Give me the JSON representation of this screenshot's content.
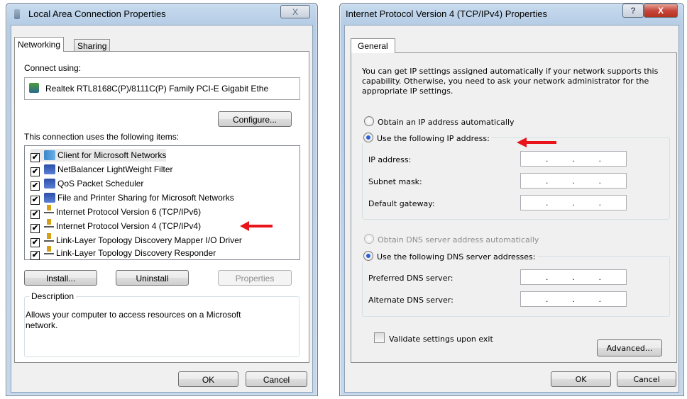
{
  "left_window": {
    "title": "Local Area Connection Properties",
    "tabs": [
      "Networking",
      "Sharing"
    ],
    "connect_using_label": "Connect using:",
    "adapter_name": "Realtek RTL8168C(P)/8111C(P) Family PCI-E Gigabit Ethe",
    "configure_button": "Configure...",
    "items_label": "This connection uses the following items:",
    "items": [
      {
        "label": "Client for Microsoft Networks",
        "checked": true,
        "icon": "network-client-icon"
      },
      {
        "label": "NetBalancer LightWeight Filter",
        "checked": true,
        "icon": "network-service-icon"
      },
      {
        "label": "QoS Packet Scheduler",
        "checked": true,
        "icon": "network-service-icon"
      },
      {
        "label": "File and Printer Sharing for Microsoft Networks",
        "checked": true,
        "icon": "network-service-icon"
      },
      {
        "label": "Internet Protocol Version 6 (TCP/IPv6)",
        "checked": true,
        "icon": "protocol-icon"
      },
      {
        "label": "Internet Protocol Version 4 (TCP/IPv4)",
        "checked": true,
        "icon": "protocol-icon"
      },
      {
        "label": "Link-Layer Topology Discovery Mapper I/O Driver",
        "checked": true,
        "icon": "protocol-icon"
      },
      {
        "label": "Link-Layer Topology Discovery Responder",
        "checked": true,
        "icon": "protocol-icon"
      }
    ],
    "install_button": "Install...",
    "uninstall_button": "Uninstall",
    "properties_button": "Properties",
    "description_caption": "Description",
    "description_text": "Allows your computer to access resources on a Microsoft network.",
    "ok_button": "OK",
    "cancel_button": "Cancel",
    "close_glyph": "X"
  },
  "right_window": {
    "title": "Internet Protocol Version 4 (TCP/IPv4) Properties",
    "tab": "General",
    "intro_text": "You can get IP settings assigned automatically if your network supports this capability. Otherwise, you need to ask your network administrator for the appropriate IP settings.",
    "obtain_ip_auto": "Obtain an IP address automatically",
    "use_following_ip": "Use the following IP address:",
    "ip_address_label": "IP address:",
    "subnet_mask_label": "Subnet mask:",
    "default_gateway_label": "Default gateway:",
    "obtain_dns_auto": "Obtain DNS server address automatically",
    "use_following_dns": "Use the following DNS server addresses:",
    "preferred_dns_label": "Preferred DNS server:",
    "alternate_dns_label": "Alternate DNS server:",
    "validate_label": "Validate settings upon exit",
    "advanced_button": "Advanced...",
    "ok_button": "OK",
    "cancel_button": "Cancel",
    "help_glyph": "?",
    "close_glyph": "X",
    "ip_dot": "."
  },
  "colors": {
    "arrow": "#e8141a",
    "close_button": "#c7463b",
    "radio_selected": "#2a5fd8"
  }
}
